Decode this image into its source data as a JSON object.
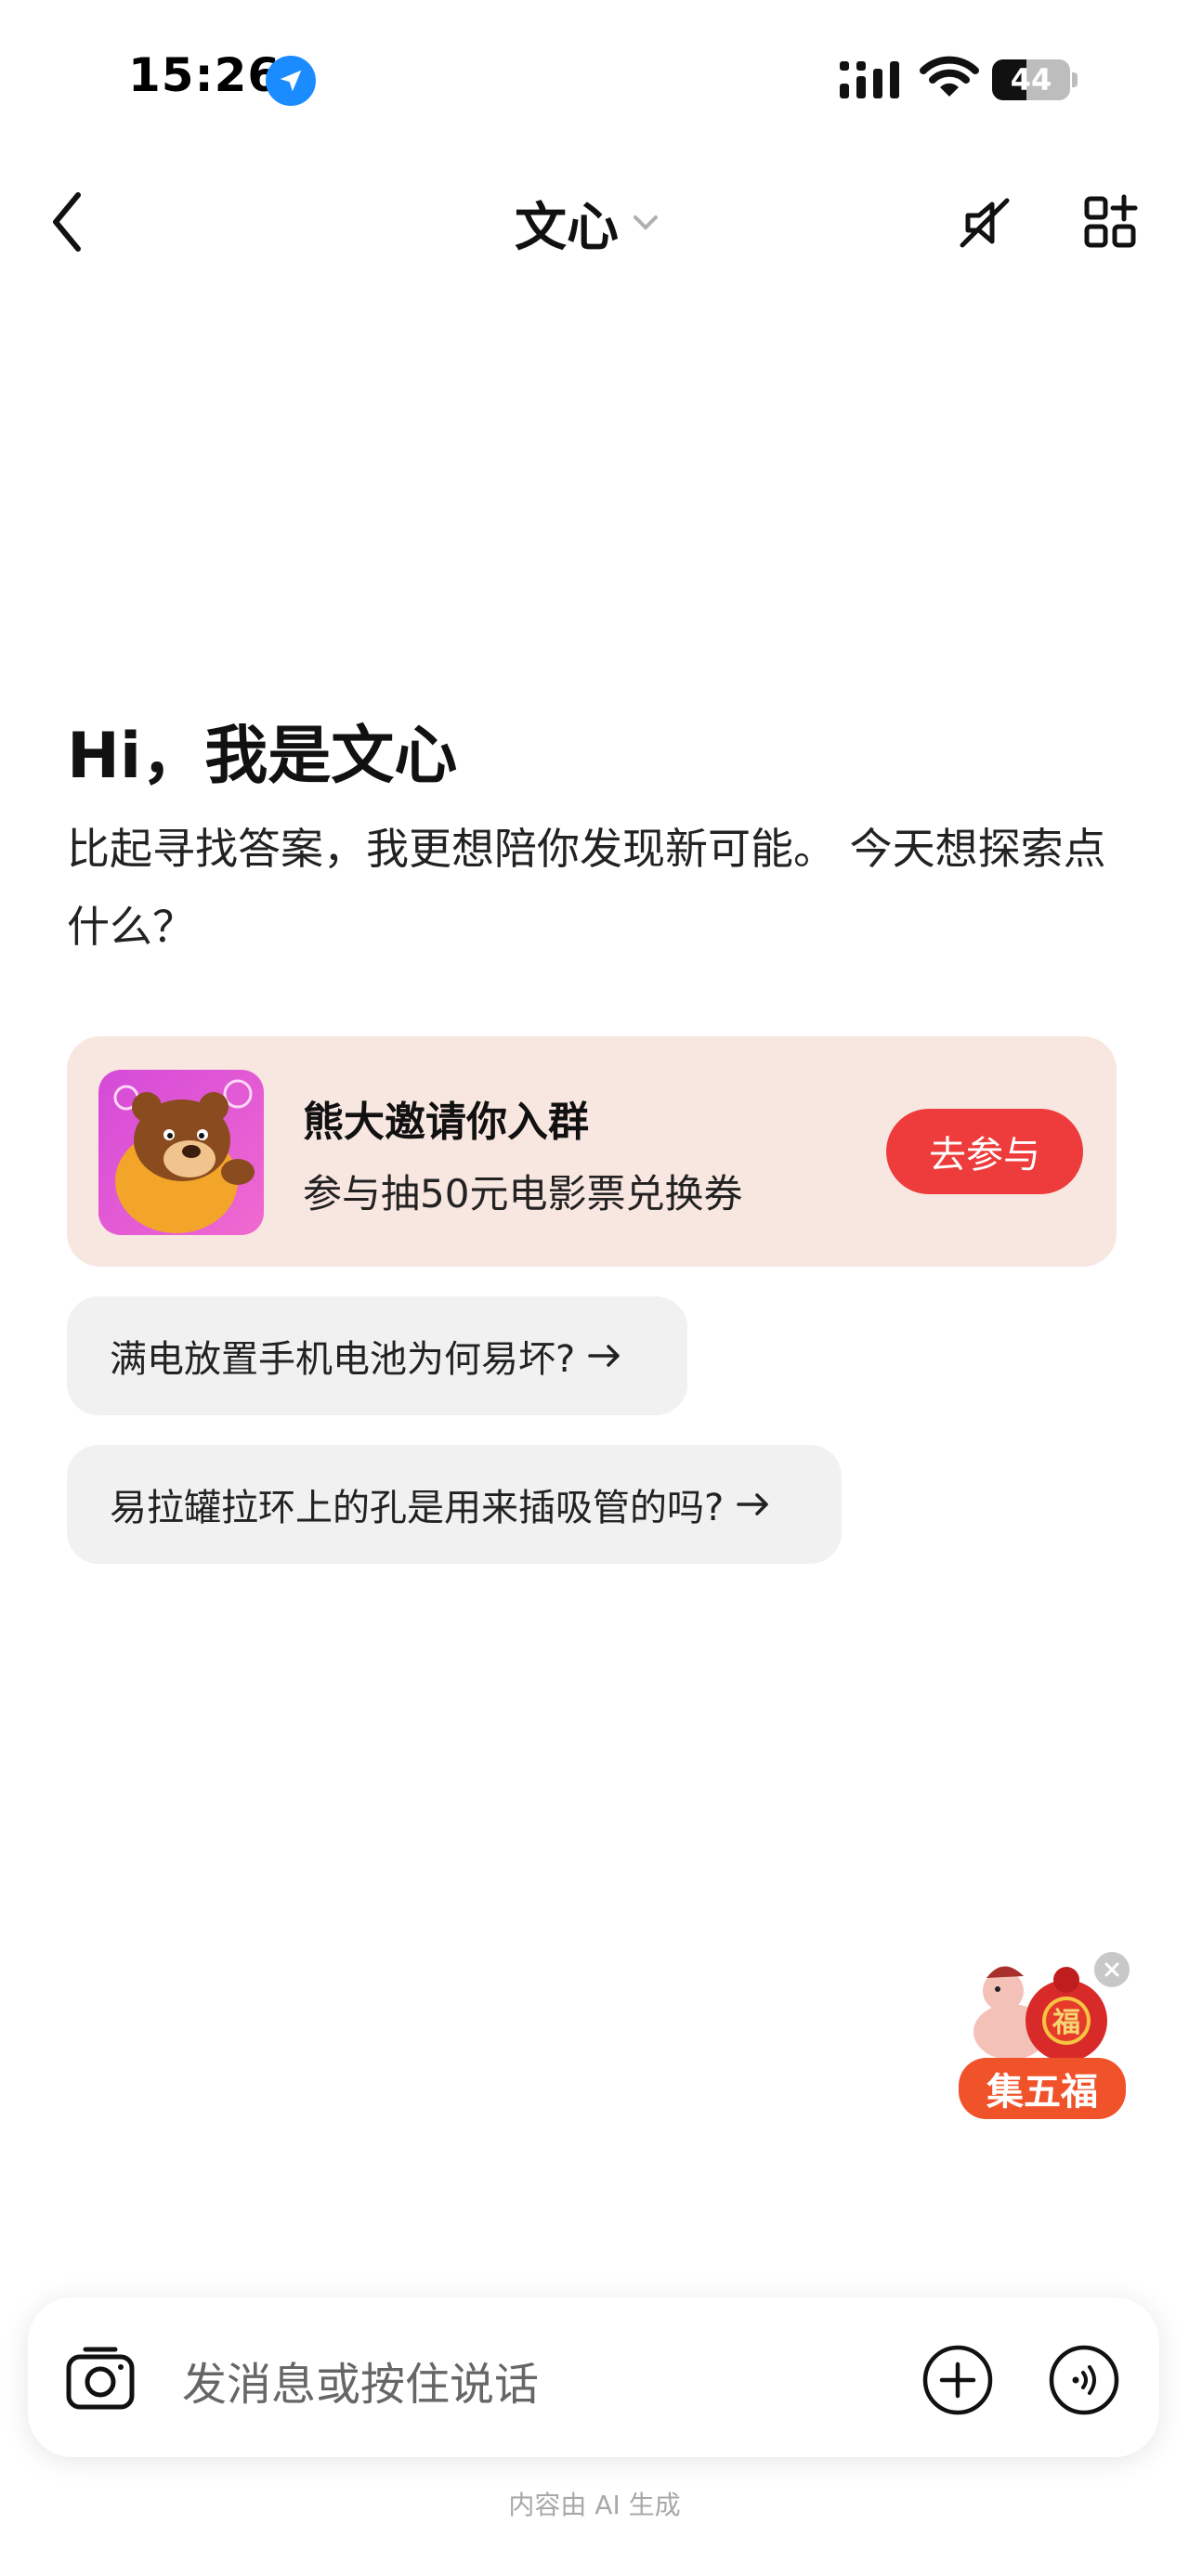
{
  "status_bar": {
    "time": "15:26",
    "battery_level": "44",
    "icons": [
      "location-arrow-icon",
      "signal-icon",
      "wifi-icon",
      "battery-icon"
    ]
  },
  "nav": {
    "title": "文心",
    "icons": [
      "back-chevron-icon",
      "chevron-down-icon",
      "mute-icon",
      "apps-grid-icon"
    ]
  },
  "intro": {
    "greeting": "Hi，我是文心",
    "subtitle": "比起寻找答案，我更想陪你发现新可能。 今天想探索点什么？"
  },
  "promo": {
    "title": "熊大邀请你入群",
    "subtitle": "参与抽50元电影票兑换券",
    "button_label": "去参与",
    "accent_color": "#ee3b3b",
    "background_color": "#f8e6e0"
  },
  "suggestions": [
    {
      "text": "满电放置手机电池为何易坏?"
    },
    {
      "text": "易拉罐拉环上的孔是用来插吸管的吗?"
    }
  ],
  "floating_badge": {
    "label": "集五福",
    "fu_char": "福"
  },
  "input": {
    "placeholder": "发消息或按住说话"
  },
  "footer": {
    "note": "内容由 AI 生成"
  }
}
